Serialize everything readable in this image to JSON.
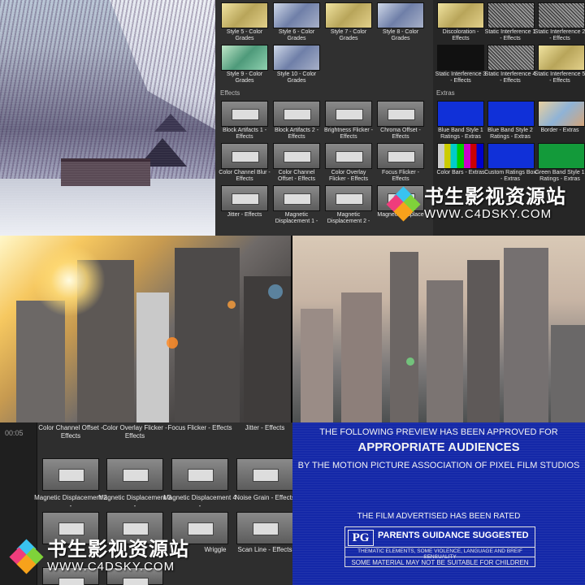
{
  "browser": {
    "top_row": [
      {
        "label": "Style 5 - Color Grades"
      },
      {
        "label": "Style 6 - Color Grades"
      },
      {
        "label": "Style 7 - Color Grades"
      },
      {
        "label": "Style 8 - Color Grades"
      }
    ],
    "second_row": [
      {
        "label": "Style 9 - Color Grades"
      },
      {
        "label": "Style 10 - Color Grades"
      }
    ],
    "effects_label": "Effects",
    "effects_rows": [
      {
        "label": "Block Artifacts 1 - Effects"
      },
      {
        "label": "Block Artifacts 2 - Effects"
      },
      {
        "label": "Brightness Flicker - Effects"
      },
      {
        "label": "Chroma Offset - Effects"
      },
      {
        "label": "Color Channel Blur - Effects"
      },
      {
        "label": "Color Channel Offset - Effects"
      },
      {
        "label": "Color Overlay Flicker - Effects"
      },
      {
        "label": "Focus Flicker - Effects"
      },
      {
        "label": "Jitter - Effects"
      },
      {
        "label": "Magnetic Displacement 1 -"
      },
      {
        "label": "Magnetic Displacement 2 -"
      },
      {
        "label": "Magnetic Displace"
      }
    ],
    "right_top": [
      {
        "label": "Discoloration - Effects"
      },
      {
        "label": "Static Interference 1 - Effects"
      },
      {
        "label": "Static Interference 2 - Effects"
      },
      {
        "label": "Static Interference 3 - Effects"
      },
      {
        "label": "Static Interference 4 - Effects"
      },
      {
        "label": "Static Interference 5 - Effects"
      }
    ],
    "extras_label": "Extras",
    "extras": [
      {
        "label": "Blue Band Style 1 Ratings - Extras"
      },
      {
        "label": "Blue Band Style 2 Ratings - Extras"
      },
      {
        "label": "Border - Extras"
      },
      {
        "label": "Color Bars - Extras"
      },
      {
        "label": "Custom Ratings Box - Extras"
      },
      {
        "label": "Green Band Style 1 Ratings - Extras"
      }
    ]
  },
  "watermark": {
    "chinese": "书生影视资源站",
    "url": "WWW.C4DSKY.COM"
  },
  "effects_list": {
    "time": "00:05",
    "items": [
      {
        "label": "Color Channel Offset - Effects"
      },
      {
        "label": "Color Overlay Flicker - Effects"
      },
      {
        "label": "Focus Flicker - Effects"
      },
      {
        "label": "Jitter - Effects"
      },
      {
        "label": "Magnetic Displacement 2 -"
      },
      {
        "label": "Magnetic Displacement 3 -"
      },
      {
        "label": "Magnetic Displacement 4 -"
      },
      {
        "label": "Noise Grain - Effects"
      },
      {
        "label": "ects"
      },
      {
        "label": "Wriggle"
      },
      {
        "label": "Scan Line - Effects"
      }
    ]
  },
  "rating": {
    "line1": "THE FOLLOWING PREVIEW HAS BEEN APPROVED FOR",
    "line2": "APPROPRIATE AUDIENCES",
    "line3": "BY THE MOTION PICTURE ASSOCIATION OF PIXEL FILM STUDIOS",
    "line4": "THE FILM ADVERTISED HAS BEEN RATED",
    "rating_code": "PG",
    "rating_text": "PARENTS GUIDANCE SUGGESTED",
    "elements": "THEMATIC ELEMENTS, SOME VIOLENCE, LANGUAGE AND BREIF SENSUALITY",
    "note": "SOME MATERIAL MAY NOT BE SUITABLE FOR CHILDREN"
  },
  "colors": {
    "rating_blue": "#1428a8",
    "browser_bg": "#303030",
    "blue_band": "#1030d8",
    "green_band": "#139a3a"
  }
}
